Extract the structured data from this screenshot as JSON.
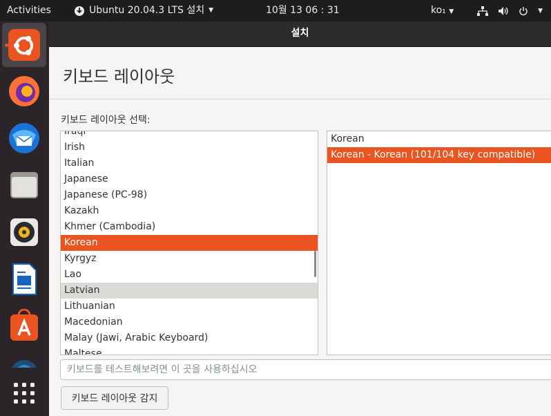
{
  "topbar": {
    "activities": "Activities",
    "app_name": "Ubuntu 20.04.3 LTS 설치",
    "clock": "10월 13  06 : 31",
    "input_method": "ko₁"
  },
  "window": {
    "title": "설치",
    "heading": "키보드 레이아웃",
    "list_caption": "키보드 레이아웃 선택:",
    "layouts": [
      "Iraqi",
      "Irish",
      "Italian",
      "Japanese",
      "Japanese (PC-98)",
      "Kazakh",
      "Khmer (Cambodia)",
      "Korean",
      "Kyrgyz",
      "Lao",
      "Latvian",
      "Lithuanian",
      "Macedonian",
      "Malay (Jawi, Arabic Keyboard)",
      "Maltese"
    ],
    "selected_layout": "Korean",
    "hovered_layout": "Latvian",
    "variants": [
      "Korean",
      "Korean - Korean (101/104 key compatible)"
    ],
    "selected_variant": "Korean - Korean (101/104 key compatible)",
    "test_placeholder": "키보드를 테스트해보려면 이 곳을 사용하십시오",
    "detect_button": "키보드 레이아웃 감지"
  },
  "colors": {
    "accent": "#e95420",
    "topbar": "#1d1d1d",
    "dock": "#2b2429"
  },
  "dock_icons": [
    "ubuntu-installer-icon",
    "firefox-icon",
    "thunderbird-icon",
    "files-icon",
    "rhythmbox-icon",
    "libreoffice-writer-icon",
    "ubuntu-software-icon",
    "help-icon",
    "show-applications-icon"
  ]
}
